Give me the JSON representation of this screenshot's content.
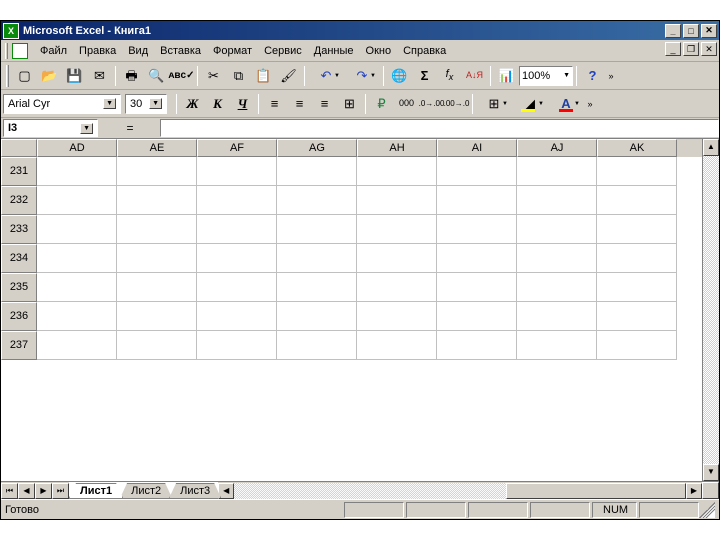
{
  "title": "Microsoft Excel - Книга1",
  "menu": {
    "file": "Файл",
    "edit": "Правка",
    "view": "Вид",
    "insert": "Вставка",
    "format": "Формат",
    "tools": "Сервис",
    "data": "Данные",
    "window": "Окно",
    "help": "Справка"
  },
  "zoom": "100%",
  "font": {
    "name": "Arial Cyr",
    "size": "30"
  },
  "format_buttons": {
    "bold": "Ж",
    "italic": "К",
    "underline": "Ч"
  },
  "namebox": "I3",
  "fx_symbol": "=",
  "formula": "",
  "columns": [
    "AD",
    "AE",
    "AF",
    "AG",
    "AH",
    "AI",
    "AJ",
    "AK"
  ],
  "rows": [
    "231",
    "232",
    "233",
    "234",
    "235",
    "236",
    "237"
  ],
  "sheets": [
    "Лист1",
    "Лист2",
    "Лист3"
  ],
  "active_sheet": 0,
  "status": {
    "ready": "Готово",
    "num": "NUM"
  },
  "currency_icon": "000"
}
